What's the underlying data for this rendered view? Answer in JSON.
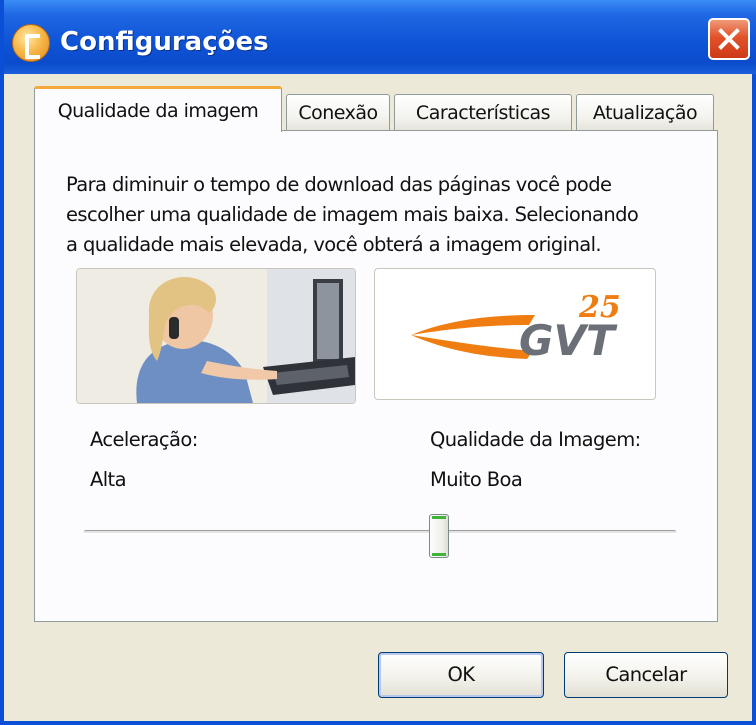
{
  "window": {
    "title": "Configurações"
  },
  "tabs": [
    {
      "label": "Qualidade da imagem",
      "active": true
    },
    {
      "label": "Conexão",
      "active": false
    },
    {
      "label": "Características",
      "active": false
    },
    {
      "label": "Atualização",
      "active": false
    }
  ],
  "main": {
    "description_lines": [
      "Para diminuir o tempo de download das páginas você pode",
      "escolher uma qualidade de imagem mais baixa. Selecionando",
      "a qualidade mais elevada, você obterá a imagem original."
    ],
    "logo": {
      "brand": "GVT",
      "badge": "25"
    },
    "acceleration_label": "Aceleração:",
    "acceleration_value": "Alta",
    "quality_label": "Qualidade da Imagem:",
    "quality_value": "Muito Boa",
    "slider_position_fraction": 0.6
  },
  "buttons": {
    "ok": "OK",
    "cancel": "Cancelar"
  },
  "colors": {
    "titlebar": "#0f55d7",
    "active_tab_accent": "#f4a93a",
    "close_button": "#e2532b",
    "logo_orange": "#ef7d12",
    "logo_gray": "#6b6f78",
    "slider_thumb_accent": "#3fb43a"
  }
}
